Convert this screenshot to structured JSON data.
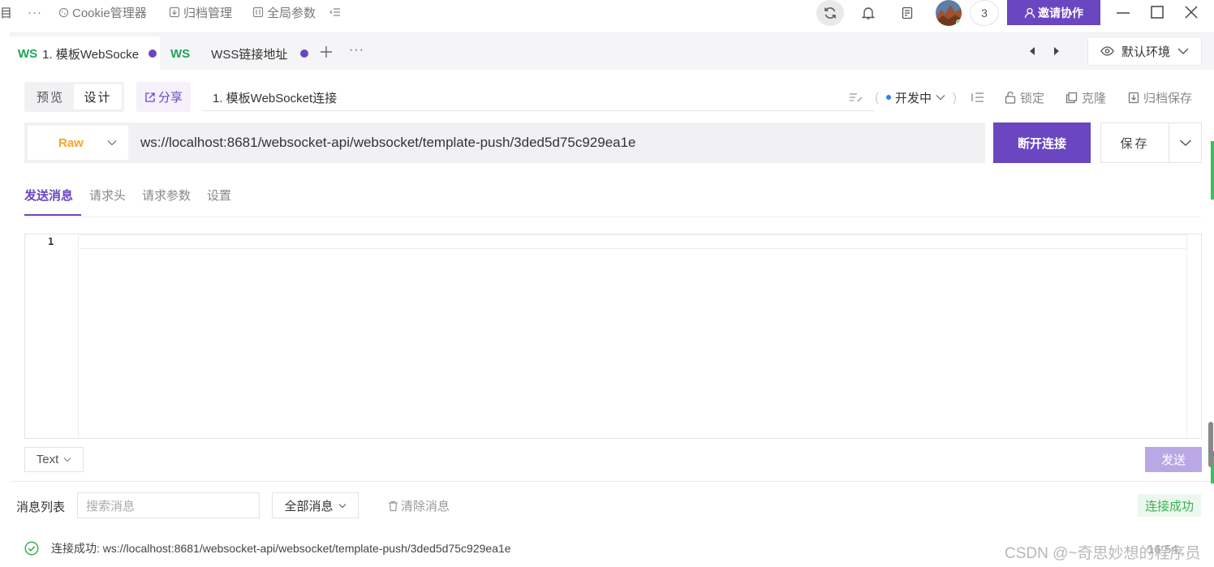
{
  "topbar": {
    "truncated_left": "目",
    "more": "···",
    "cookie": "Cookie管理器",
    "archive": "归档管理",
    "global_params": "全局参数",
    "member_count": "3",
    "invite": "邀请协作"
  },
  "tabs": [
    {
      "tag": "WS",
      "label": "1. 模板WebSocke",
      "unsaved": true,
      "active": true
    },
    {
      "tag": "WS",
      "label": "WSS链接地址",
      "unsaved": true,
      "active": false
    }
  ],
  "tabbar": {
    "more": "···"
  },
  "environment": {
    "label": "默认环境"
  },
  "toolbar": {
    "preview": "预览",
    "design": "设计",
    "share": "分享",
    "request_name": "1.  模板WebSocket连接",
    "status": "开发中",
    "lock": "锁定",
    "clone": "克隆",
    "archive_save": "归档保存"
  },
  "url_bar": {
    "format": "Raw",
    "url": "ws://localhost:8681/websocket-api/websocket/template-push/3ded5d75c929ea1e",
    "disconnect": "断开连接",
    "save": "保存"
  },
  "subtabs": [
    {
      "label": "发送消息",
      "active": true
    },
    {
      "label": "请求头",
      "active": false
    },
    {
      "label": "请求参数",
      "active": false
    },
    {
      "label": "设置",
      "active": false
    }
  ],
  "editor": {
    "line_number": "1",
    "content": ""
  },
  "message_type": "Text",
  "send": "发送",
  "messages": {
    "title": "消息列表",
    "search_placeholder": "搜索消息",
    "filter": "全部消息",
    "clear": "清除消息",
    "status": "连接成功",
    "items": [
      {
        "text": "连接成功: ws://localhost:8681/websocket-api/websocket/template-push/3ded5d75c929ea1e",
        "time": "16:54"
      }
    ]
  },
  "watermark": "CSDN @~奇思妙想的程序员",
  "colors": {
    "accent": "#6b46c1",
    "ws_tag": "#21a454",
    "raw": "#f5a623",
    "success": "#3cb054"
  }
}
